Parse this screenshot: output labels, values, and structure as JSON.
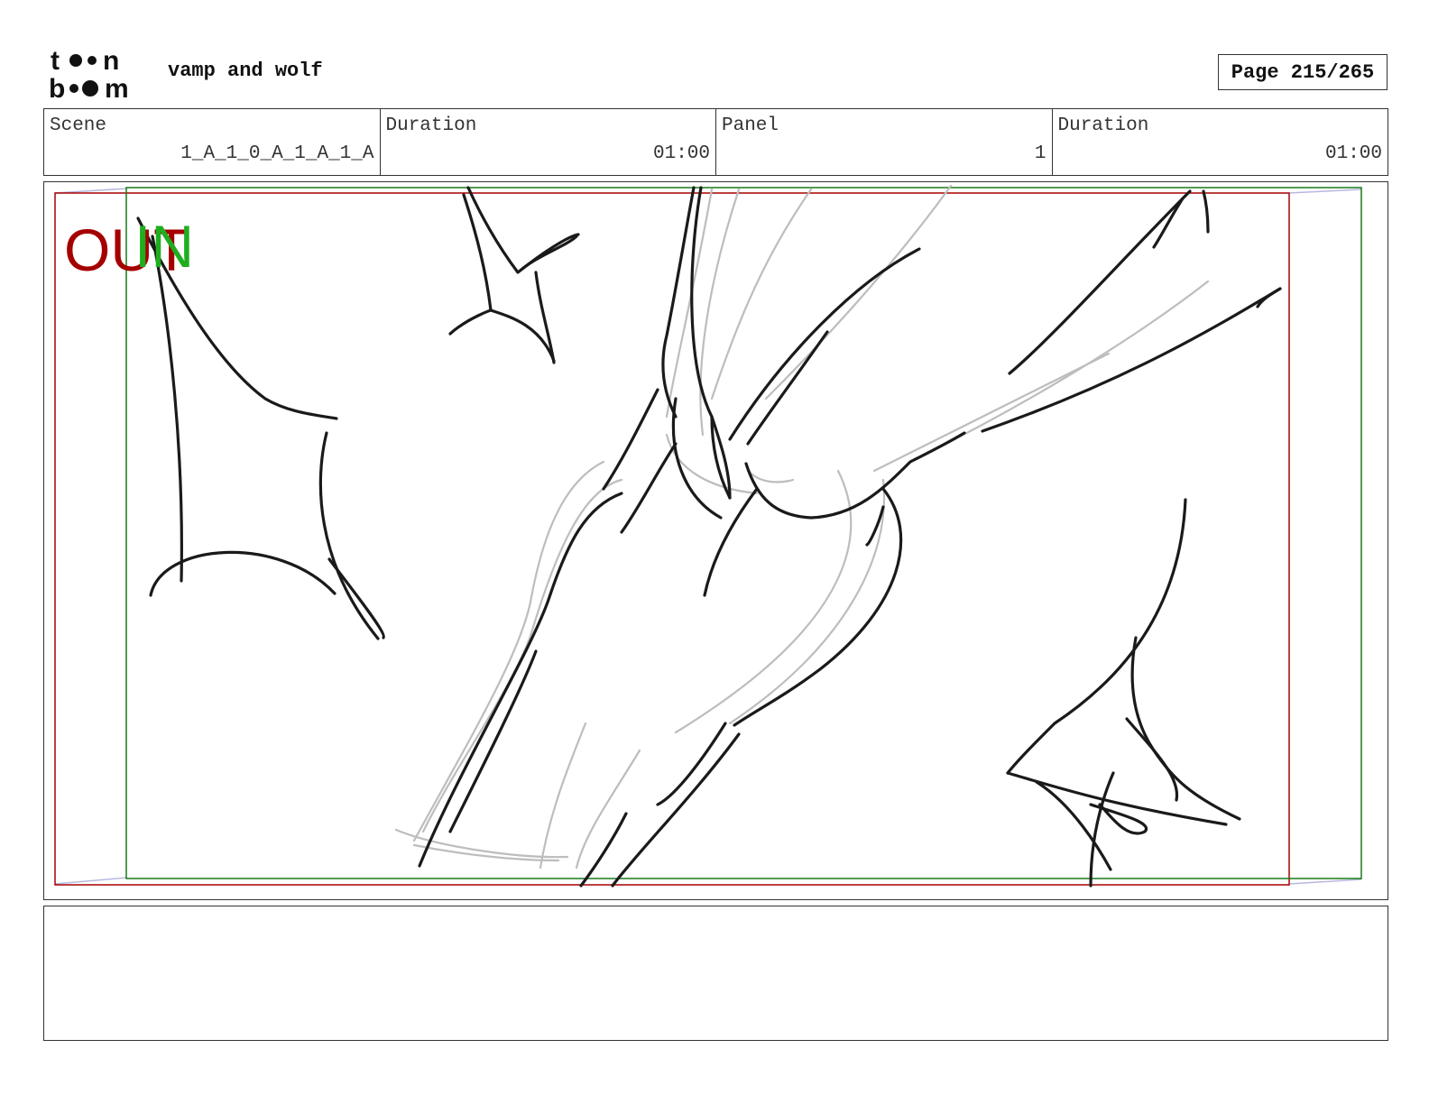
{
  "header": {
    "logo_text_top": "t●●n",
    "logo_text_bottom": "b●●m",
    "project_title": "vamp and wolf",
    "page_label": "Page 215/265"
  },
  "info": {
    "scene_label": "Scene",
    "scene_value": "1_A_1_0_A_1_A_1_A",
    "scene_duration_label": "Duration",
    "scene_duration_value": "01:00",
    "panel_label": "Panel",
    "panel_value": "1",
    "panel_duration_label": "Duration",
    "panel_duration_value": "01:00"
  },
  "frame": {
    "out_label": "OUT",
    "in_label": "IN",
    "out_color": "#a50000",
    "in_color": "#1fae1f",
    "sketch_color": "#1a1a1a",
    "rough_color": "#bdbdbd"
  },
  "notes": {
    "text": ""
  }
}
